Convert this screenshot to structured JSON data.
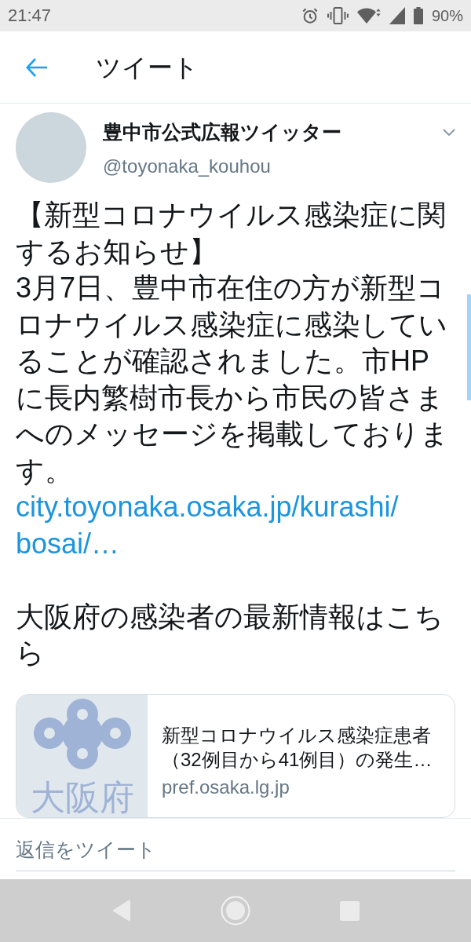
{
  "status_bar": {
    "time": "21:47",
    "battery": "90%"
  },
  "header": {
    "title": "ツイート"
  },
  "tweet": {
    "author": {
      "name": "豊中市公式広報ツイッター",
      "handle": "@toyonaka_kouhou"
    },
    "body": [
      [
        {
          "kind": "text",
          "text": "【新型コロナウイルス感染症に関するお知らせ】"
        },
        {
          "kind": "text",
          "text": "3月7日、豊中市在住の方が新型コロナウイルス感染症に感染していることが確認されました。市HPに長内繁樹市長から市民の皆さまへのメッセージを掲載しております。"
        },
        {
          "kind": "link",
          "text": "city.toyonaka.osaka.jp/kurashi/bosai/…"
        }
      ],
      [
        {
          "kind": "text",
          "text": "大阪府の感染者の最新情報はこちら"
        }
      ]
    ],
    "card": {
      "logo_text": "大阪府",
      "title": "新型コロナウイルス感染症患者（32例目から41例目）の発生…",
      "domain": "pref.osaka.lg.jp"
    }
  },
  "reply": {
    "placeholder": "返信をツイート"
  }
}
